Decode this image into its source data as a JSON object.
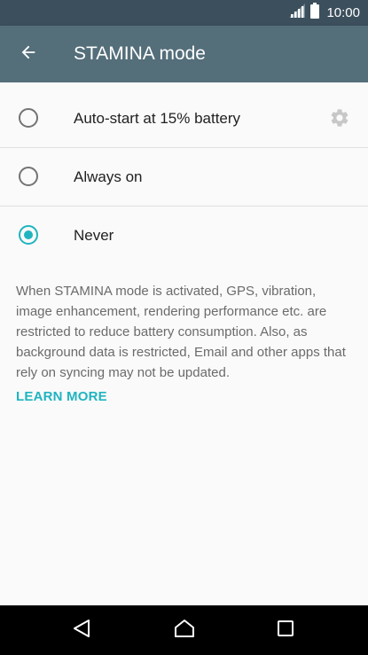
{
  "status_bar": {
    "time": "10:00",
    "icons": [
      "signal-icon",
      "battery-icon"
    ]
  },
  "app_bar": {
    "title": "STAMINA mode",
    "back_icon": "arrow-left-icon"
  },
  "options": [
    {
      "label": "Auto-start at 15% battery",
      "selected": false,
      "has_settings": true
    },
    {
      "label": "Always on",
      "selected": false
    },
    {
      "label": "Never",
      "selected": true
    }
  ],
  "description": "When STAMINA mode is activated, GPS, vibration, image enhancement, rendering performance etc. are restricted to reduce battery consumption. Also, as background data is restricted, Email and other apps that rely on syncing may not be updated.",
  "learn_more": "LEARN MORE",
  "nav_bar": {
    "buttons": [
      "back-triangle-icon",
      "home-icon",
      "recents-icon"
    ]
  },
  "colors": {
    "status_bar": "#3c4f5d",
    "app_bar": "#546e7a",
    "accent": "#20b4c0",
    "background": "#fafafa",
    "nav_bar": "#000000"
  }
}
